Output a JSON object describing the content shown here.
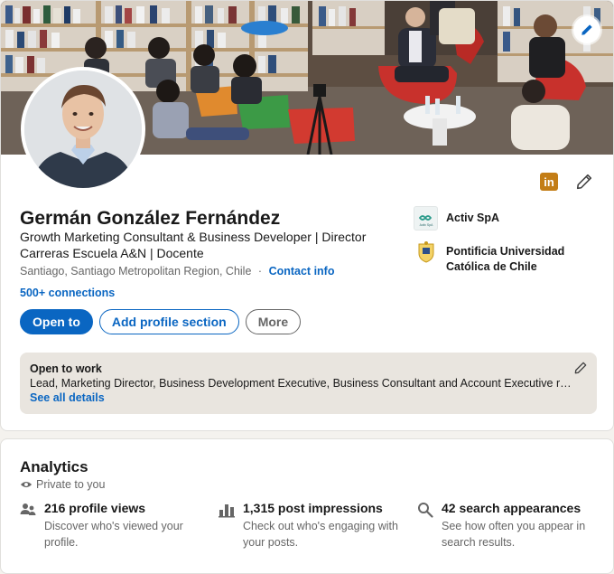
{
  "profile": {
    "name": "Germán González Fernández",
    "headline": "Growth Marketing Consultant & Business Developer | Director Carreras Escuela A&N | Docente",
    "location": "Santiago, Santiago Metropolitan Region, Chile",
    "separator": "·",
    "contact_info_label": "Contact info",
    "connections_label": "500+ connections",
    "linkedin_badge": "in"
  },
  "experience": [
    {
      "name": "Activ SpA",
      "logo_text": "Activ SpA"
    },
    {
      "name": "Pontificia Universidad Católica de Chile"
    }
  ],
  "actions": {
    "open_to": "Open to",
    "add_section": "Add profile section",
    "more": "More"
  },
  "open_to_work": {
    "title": "Open to work",
    "roles": "Lead, Marketing Director, Business Development Executive, Business Consultant and Account Executive roles",
    "see_all": "See all details"
  },
  "analytics": {
    "title": "Analytics",
    "visibility": "Private to you",
    "items": [
      {
        "metric": "216 profile views",
        "description": "Discover who's viewed your profile.",
        "icon": "people-icon"
      },
      {
        "metric": "1,315 post impressions",
        "description": "Check out who's engaging with your posts.",
        "icon": "bar-chart-icon"
      },
      {
        "metric": "42 search appearances",
        "description": "See how often you appear in search results.",
        "icon": "search-icon"
      }
    ]
  },
  "colors": {
    "brand_blue": "#0a66c2",
    "linkedin_badge": "#c37d16",
    "open_to_work_bg": "#e9e5df",
    "page_bg": "#f4f2ee"
  }
}
